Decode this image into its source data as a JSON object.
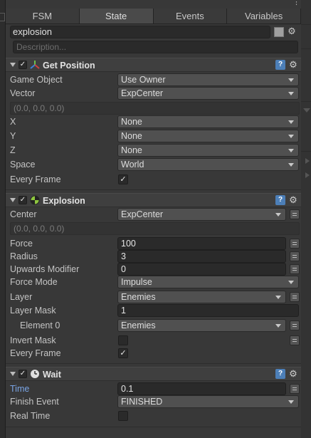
{
  "tabs": [
    "FSM",
    "State",
    "Events",
    "Variables"
  ],
  "active_tab": "State",
  "state": {
    "name": "explosion",
    "description_placeholder": "Description..."
  },
  "actions": [
    {
      "title": "Get Position",
      "icon": "transform-icon",
      "enabled": true,
      "fields": {
        "game_object": {
          "label": "Game Object",
          "value": "Use Owner"
        },
        "vector": {
          "label": "Vector",
          "value": "ExpCenter"
        },
        "vector_readout": "(0.0, 0.0, 0.0)",
        "x": {
          "label": "X",
          "value": "None"
        },
        "y": {
          "label": "Y",
          "value": "None"
        },
        "z": {
          "label": "Z",
          "value": "None"
        },
        "space": {
          "label": "Space",
          "value": "World"
        },
        "every_frame": {
          "label": "Every Frame",
          "checked": true
        }
      }
    },
    {
      "title": "Explosion",
      "icon": "physics-icon",
      "enabled": true,
      "fields": {
        "center": {
          "label": "Center",
          "value": "ExpCenter"
        },
        "center_readout": "(0.0, 0.0, 0.0)",
        "force": {
          "label": "Force",
          "value": "100"
        },
        "radius": {
          "label": "Radius",
          "value": "3"
        },
        "upwards_modifier": {
          "label": "Upwards Modifier",
          "value": "0"
        },
        "force_mode": {
          "label": "Force Mode",
          "value": "Impulse"
        },
        "layer": {
          "label": "Layer",
          "value": "Enemies"
        },
        "layer_mask": {
          "label": "Layer Mask",
          "value": "1"
        },
        "element_0": {
          "label": "Element 0",
          "value": "Enemies"
        },
        "invert_mask": {
          "label": "Invert Mask",
          "checked": false
        },
        "every_frame": {
          "label": "Every Frame",
          "checked": true
        }
      }
    },
    {
      "title": "Wait",
      "icon": "clock-icon",
      "enabled": true,
      "fields": {
        "time": {
          "label": "Time",
          "value": "0.1"
        },
        "finish_event": {
          "label": "Finish Event",
          "value": "FINISHED"
        },
        "real_time": {
          "label": "Real Time",
          "checked": false
        }
      }
    }
  ],
  "colors": {
    "help": "#4c7fb8",
    "highlight_label": "#7aa5e6"
  }
}
